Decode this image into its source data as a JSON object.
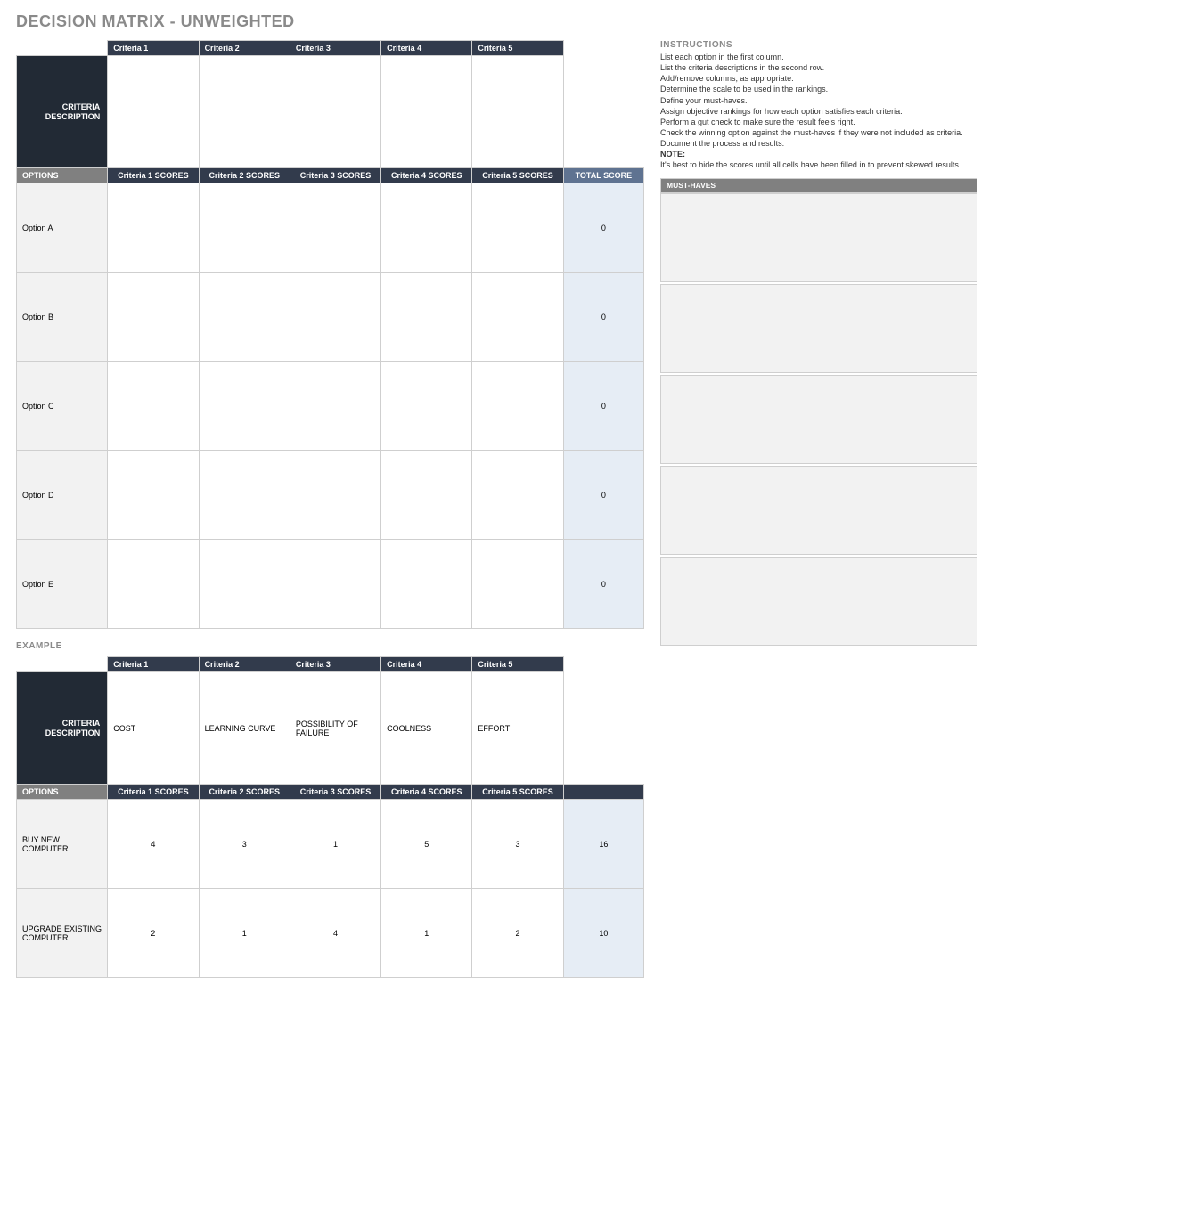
{
  "title": "DECISION MATRIX - UNWEIGHTED",
  "main": {
    "criteria_desc_label": "CRITERIA\nDESCRIPTION",
    "options_header": "OPTIONS",
    "total_header": "TOTAL SCORE",
    "criteria_headers": [
      "Criteria 1",
      "Criteria 2",
      "Criteria 3",
      "Criteria 4",
      "Criteria 5"
    ],
    "criteria_descriptions": [
      "",
      "",
      "",
      "",
      ""
    ],
    "score_headers": [
      "Criteria 1 SCORES",
      "Criteria 2 SCORES",
      "Criteria 3 SCORES",
      "Criteria 4 SCORES",
      "Criteria 5 SCORES"
    ],
    "options": [
      {
        "name": "Option A",
        "scores": [
          "",
          "",
          "",
          "",
          ""
        ],
        "total": "0"
      },
      {
        "name": "Option B",
        "scores": [
          "",
          "",
          "",
          "",
          ""
        ],
        "total": "0"
      },
      {
        "name": "Option C",
        "scores": [
          "",
          "",
          "",
          "",
          ""
        ],
        "total": "0"
      },
      {
        "name": "Option D",
        "scores": [
          "",
          "",
          "",
          "",
          ""
        ],
        "total": "0"
      },
      {
        "name": "Option E",
        "scores": [
          "",
          "",
          "",
          "",
          ""
        ],
        "total": "0"
      }
    ]
  },
  "example": {
    "label": "EXAMPLE",
    "criteria_desc_label": "CRITERIA\nDESCRIPTION",
    "options_header": "OPTIONS",
    "criteria_headers": [
      "Criteria 1",
      "Criteria 2",
      "Criteria 3",
      "Criteria 4",
      "Criteria 5"
    ],
    "criteria_descriptions": [
      "COST",
      "LEARNING CURVE",
      "POSSIBILITY OF FAILURE",
      "COOLNESS",
      "EFFORT"
    ],
    "score_headers": [
      "Criteria 1 SCORES",
      "Criteria 2 SCORES",
      "Criteria 3 SCORES",
      "Criteria 4 SCORES",
      "Criteria 5 SCORES"
    ],
    "options": [
      {
        "name": "BUY NEW COMPUTER",
        "scores": [
          "4",
          "3",
          "1",
          "5",
          "3"
        ],
        "total": "16"
      },
      {
        "name": "UPGRADE EXISTING COMPUTER",
        "scores": [
          "2",
          "1",
          "4",
          "1",
          "2"
        ],
        "total": "10"
      }
    ]
  },
  "instructions": {
    "title": "INSTRUCTIONS",
    "lines": [
      "List each option in the first column.",
      "List the criteria descriptions in the second row.",
      "Add/remove columns, as appropriate.",
      "Determine the scale to be used in the rankings.",
      "Define your must-haves.",
      "Assign objective rankings for how each option satisfies each criteria.",
      "Perform a gut check to make sure the result feels right.",
      "Check the winning option against the must-haves if they were not included as criteria.",
      "Document the process and results."
    ],
    "note_label": "NOTE:",
    "note_text": "It's best to hide the scores until all cells have been filled in to prevent skewed results."
  },
  "musthaves": {
    "header": "MUST-HAVES",
    "boxes": [
      "",
      "",
      "",
      "",
      ""
    ]
  }
}
